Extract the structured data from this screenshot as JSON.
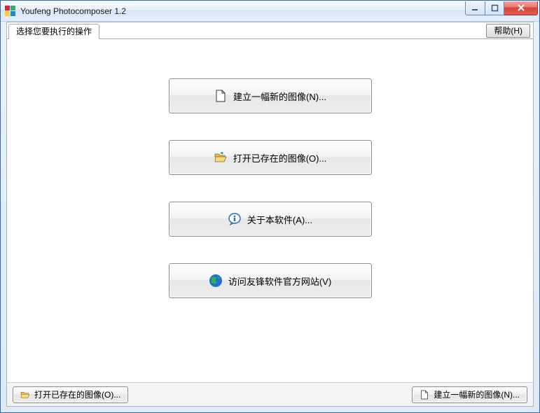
{
  "window": {
    "title": "Youfeng Photocomposer 1.2"
  },
  "tab": {
    "label": "选择您要执行的操作"
  },
  "help": {
    "label": "帮助(H)"
  },
  "buttons": {
    "new_image": "建立一幅新的图像(N)...",
    "open_image": "打开已存在的图像(O)...",
    "about": "关于本软件(A)...",
    "website": "访问友锋软件官方网站(V)"
  },
  "footer": {
    "open_image": "打开已存在的图像(O)...",
    "new_image": "建立一幅新的图像(N)..."
  }
}
